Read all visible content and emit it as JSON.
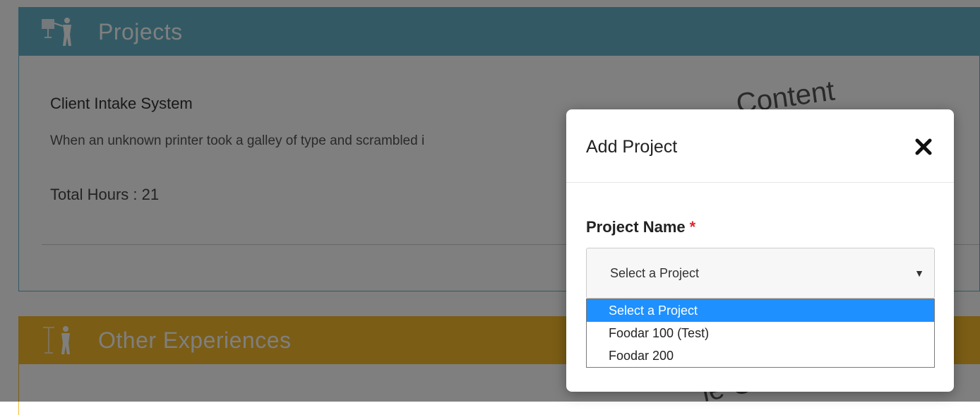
{
  "projects_panel": {
    "title": "Projects",
    "header_color": "#67b4c8",
    "icon": "presentation-icon",
    "project": {
      "name": "Client Intake System",
      "description": "When an unknown printer took a galley of type and scrambled i",
      "hours": "Total Hours : 21"
    },
    "watermark": "Content"
  },
  "other_panel": {
    "title": "Other Experiences",
    "header_color": "#f6bb2b",
    "icon": "experience-icon",
    "watermark": "le Co"
  },
  "modal": {
    "title": "Add Project",
    "close_icon": "close-icon",
    "field_label": "Project Name",
    "required_mark": "*",
    "select": {
      "value": "Select a Project",
      "caret": "▼",
      "options": [
        "Select a Project",
        "Foodar 100 (Test)",
        "Foodar 200"
      ],
      "highlighted_index": 0
    }
  },
  "colors": {
    "highlight": "#1e90ff",
    "required": "#e0262b"
  }
}
